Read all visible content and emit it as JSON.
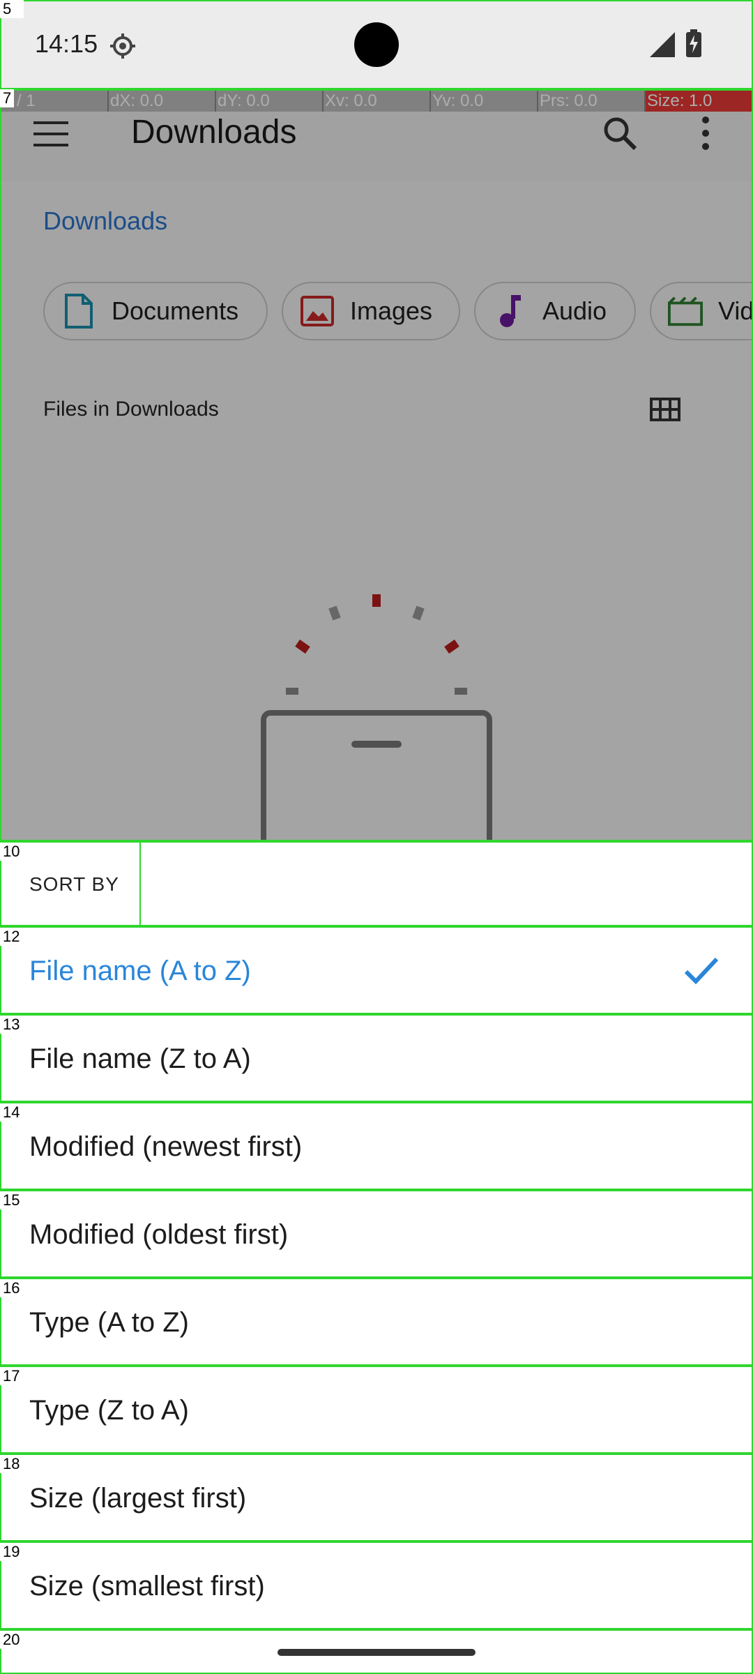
{
  "status_bar": {
    "time": "14:15",
    "icons": [
      "settings-gear-icon",
      "signal-icon",
      "battery-charging-icon"
    ]
  },
  "pointer_overlay": {
    "cells": [
      "0 / 1",
      "dX: 0.0",
      "dY: 0.0",
      "Xv: 0.0",
      "Yv: 0.0",
      "Prs: 0.0",
      "Size: 1.0"
    ],
    "highlight_color": "#e53935"
  },
  "app_bar": {
    "title": "Downloads",
    "icons": [
      "menu-icon",
      "search-icon",
      "more-vert-icon"
    ]
  },
  "breadcrumb": {
    "label": "Downloads"
  },
  "chips": [
    {
      "label": "Documents",
      "icon": "document-icon",
      "color": "#1a8ca8"
    },
    {
      "label": "Images",
      "icon": "image-icon",
      "color": "#c62828"
    },
    {
      "label": "Audio",
      "icon": "music-note-icon",
      "color": "#6a1b9a"
    },
    {
      "label": "Vid",
      "icon": "movie-icon",
      "color": "#2e7d32"
    }
  ],
  "files_section": {
    "heading": "Files in Downloads",
    "view_toggle_icon": "grid-view-icon"
  },
  "sort_sheet": {
    "title": "SORT BY",
    "options": [
      {
        "label": "File name (A to Z)",
        "selected": true
      },
      {
        "label": "File name (Z to A)",
        "selected": false
      },
      {
        "label": "Modified (newest first)",
        "selected": false
      },
      {
        "label": "Modified (oldest first)",
        "selected": false
      },
      {
        "label": "Type (A to Z)",
        "selected": false
      },
      {
        "label": "Type (Z to A)",
        "selected": false
      },
      {
        "label": "Size (largest first)",
        "selected": false
      },
      {
        "label": "Size (smallest first)",
        "selected": false
      }
    ],
    "accent_color": "#2a86d9"
  },
  "debug_boxes": {
    "labels": [
      "5",
      "7",
      "10",
      "12",
      "13",
      "14",
      "15",
      "16",
      "17",
      "18",
      "19",
      "20"
    ]
  }
}
